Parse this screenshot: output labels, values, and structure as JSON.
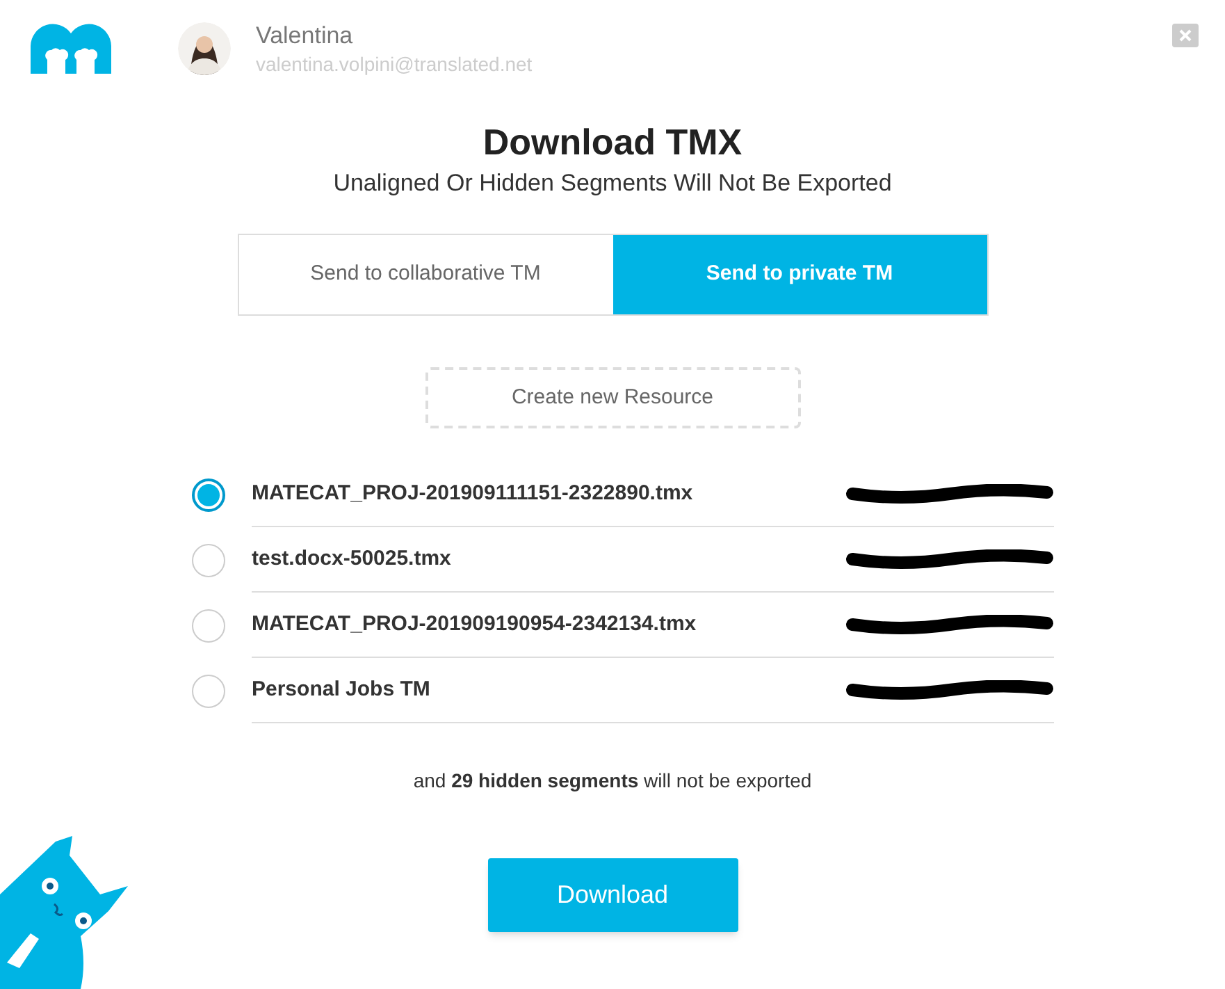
{
  "user": {
    "name": "Valentina",
    "email": "valentina.volpini@translated.net"
  },
  "title": "Download TMX",
  "subtitle": "Unaligned Or Hidden Segments Will Not Be Exported",
  "tabs": [
    {
      "label": "Send to collaborative TM",
      "selected": false
    },
    {
      "label": "Send to private TM",
      "selected": true
    }
  ],
  "create_button": "Create new Resource",
  "resources": [
    {
      "name": "MATECAT_PROJ-201909111151-2322890.tmx",
      "selected": true
    },
    {
      "name": "test.docx-50025.tmx",
      "selected": false
    },
    {
      "name": "MATECAT_PROJ-201909190954-2342134.tmx",
      "selected": false
    },
    {
      "name": "Personal Jobs TM",
      "selected": false
    }
  ],
  "note": "and **29 hidden segments** will not be exported",
  "download_button": "Download"
}
